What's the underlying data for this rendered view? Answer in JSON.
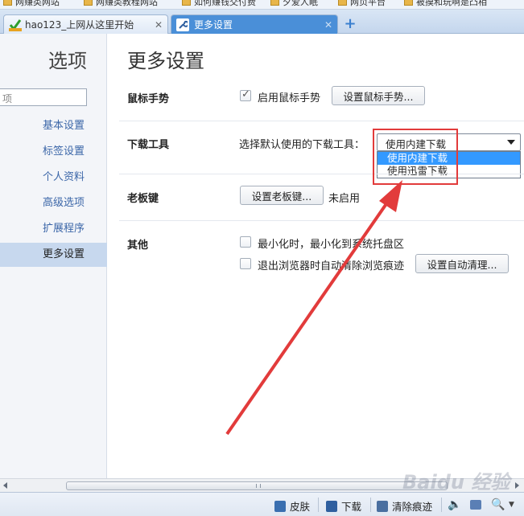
{
  "bookmarks": [
    "网赚类网站",
    "网赚类教程网站",
    "如何赚钱交付费",
    "夕爱人眠",
    "网页平台",
    "被摸和玩啊是凸相"
  ],
  "tabs": [
    {
      "label": "hao123_上网从这里开始",
      "icon": "hao123-logo-icon",
      "active": false
    },
    {
      "label": "更多设置",
      "icon": "wrench-icon",
      "active": true
    }
  ],
  "new_tab_label": "+",
  "sidebar": {
    "title": "选项",
    "search_placeholder": "项",
    "items": [
      {
        "label": "基本设置",
        "selected": false
      },
      {
        "label": "标签设置",
        "selected": false
      },
      {
        "label": "个人资料",
        "selected": false
      },
      {
        "label": "高级选项",
        "selected": false
      },
      {
        "label": "扩展程序",
        "selected": false
      },
      {
        "label": "更多设置",
        "selected": true
      }
    ]
  },
  "main": {
    "title": "更多设置",
    "mouse_gesture": {
      "label": "鼠标手势",
      "checkbox_label": "启用鼠标手势",
      "checked": true,
      "button": "设置鼠标手势..."
    },
    "download": {
      "label": "下载工具",
      "prompt": "选择默认使用的下载工具：",
      "selected": "使用内建下载",
      "options": [
        "使用内建下载",
        "使用迅雷下载"
      ],
      "highlighted_option": "使用内建下载"
    },
    "boss_key": {
      "label": "老板键",
      "button": "设置老板键...",
      "status": "未启用"
    },
    "other": {
      "label": "其他",
      "minimize_label": "最小化时，最小化到系统托盘区",
      "minimize_checked": false,
      "clear_label": "退出浏览器时自动清除浏览痕迹",
      "clear_checked": false,
      "clear_button": "设置自动清理..."
    }
  },
  "statusbar": {
    "skin": "皮肤",
    "download": "下载",
    "clear": "清除痕迹"
  },
  "watermark": "Baidu 经验",
  "colors": {
    "accent_blue": "#4a8fd8",
    "dropdown_highlight": "#3399ff",
    "annotation_red": "#e23b3b",
    "nav_link": "#3b66a8"
  }
}
